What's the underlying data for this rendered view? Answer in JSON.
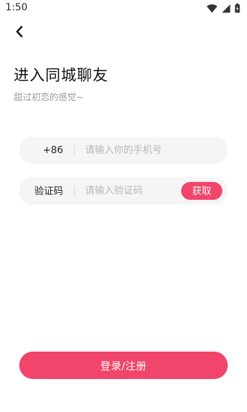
{
  "status_bar": {
    "time": "1:50",
    "icons": [
      "wifi-icon",
      "signal-icon",
      "battery-icon"
    ]
  },
  "header": {
    "back_icon": "chevron-left-icon"
  },
  "main": {
    "title": "进入同城聊友",
    "subtitle": "甜过初恋的感觉~"
  },
  "phone_field": {
    "country_code": "+86",
    "value": "",
    "placeholder": "请输入你的手机号"
  },
  "code_field": {
    "label": "验证码",
    "value": "",
    "placeholder": "请输入验证码",
    "get_code_label": "获取"
  },
  "submit": {
    "label": "登录/注册"
  },
  "colors": {
    "accent": "#f1456b",
    "field_background": "#f5f5f5",
    "placeholder": "#b8b8b8",
    "subtitle": "#9a9a9a"
  }
}
